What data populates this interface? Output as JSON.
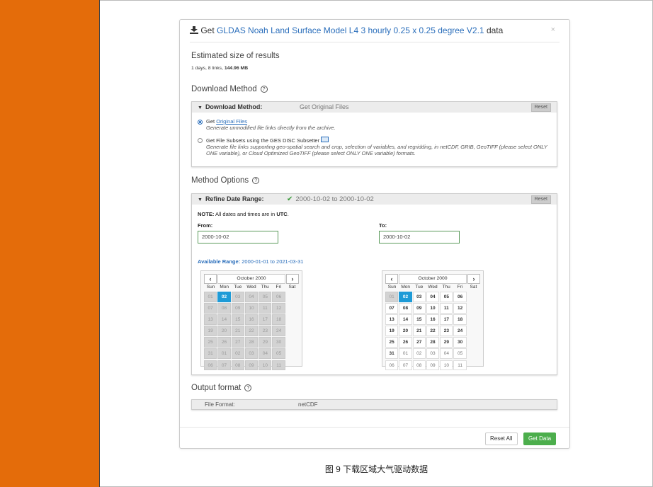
{
  "header": {
    "prefix": "Get ",
    "dataset": "GLDAS Noah Land Surface Model L4 3 hourly 0.25 x 0.25 degree V2.1",
    "suffix": " data",
    "close": "×"
  },
  "estimate": {
    "title": "Estimated size of results",
    "detail_a": "1 days, 8 links, ",
    "detail_b": "144.96 MB"
  },
  "download": {
    "section_title": "Download Method",
    "help": "?",
    "panel_title": "Download Method:",
    "panel_value": "Get Original Files",
    "reset": "Reset",
    "option1": {
      "prefix": "Get ",
      "link": "Original Files",
      "desc": "Generate unmodified file links directly from the archive."
    },
    "option2": {
      "title": "Get File Subsets using the GES DISC Subsetter",
      "desc": "Generate file links supporting geo-spatial search and crop, selection of variables, and regridding, in netCDF, GRIB, GeoTIFF (please select ONLY ONE variable), or Cloud Optimized GeoTIFF (please select ONLY ONE variable) formats."
    }
  },
  "method": {
    "section_title": "Method Options",
    "help": "?",
    "panel_title": "Refine Date Range:",
    "check": "✔",
    "panel_value": "2000-10-02 to 2000-10-02",
    "reset": "Reset",
    "note_bold": "NOTE:",
    "note_a": " All dates and times are in ",
    "note_utc": "UTC",
    "note_end": ".",
    "from_label": "From:",
    "from_value": "2000-10-02",
    "to_label": "To:",
    "to_value": "2000-10-02",
    "avail_label": "Available Range:",
    "avail_value": " 2000-01-01 to 2021-03-31"
  },
  "calendar_left": {
    "month": "October 2000",
    "prev": "‹",
    "next": "›",
    "dow": [
      "Sun",
      "Mon",
      "Tue",
      "Wed",
      "Thu",
      "Fri",
      "Sat"
    ],
    "days": [
      "01",
      "02",
      "03",
      "04",
      "05",
      "06",
      "07",
      "08",
      "09",
      "10",
      "11",
      "12",
      "13",
      "14",
      "15",
      "16",
      "17",
      "18",
      "19",
      "20",
      "21",
      "22",
      "23",
      "24",
      "25",
      "26",
      "27",
      "28",
      "29",
      "30",
      "31",
      "01",
      "02",
      "03",
      "04",
      "05",
      "06",
      "07",
      "08",
      "09",
      "10",
      "11"
    ]
  },
  "calendar_right": {
    "month": "October 2000",
    "prev": "‹",
    "next": "›",
    "dow": [
      "Sun",
      "Mon",
      "Tue",
      "Wed",
      "Thu",
      "Fri",
      "Sat"
    ],
    "days": [
      "01",
      "02",
      "03",
      "04",
      "05",
      "06",
      "07",
      "08",
      "09",
      "10",
      "11",
      "12",
      "13",
      "14",
      "15",
      "16",
      "17",
      "18",
      "19",
      "20",
      "21",
      "22",
      "23",
      "24",
      "25",
      "26",
      "27",
      "28",
      "29",
      "30",
      "31",
      "01",
      "02",
      "03",
      "04",
      "05",
      "06",
      "07",
      "08",
      "09",
      "10",
      "11"
    ]
  },
  "output": {
    "section_title": "Output format",
    "help": "?",
    "label": "File Format:",
    "value": "netCDF"
  },
  "buttons": {
    "reset_all": "Reset All",
    "get_data": "Get Data"
  },
  "caption": "图 9 下载区域大气驱动数据"
}
